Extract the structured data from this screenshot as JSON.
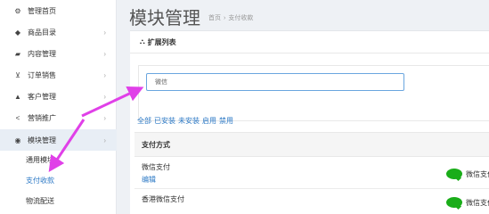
{
  "sidebar": {
    "items": [
      {
        "label": "管理首页",
        "icon": "dashboard-icon",
        "glyph": "⚙"
      },
      {
        "label": "商品目录",
        "icon": "tag-icon",
        "glyph": "◆"
      },
      {
        "label": "内容管理",
        "icon": "book-icon",
        "glyph": "▰"
      },
      {
        "label": "订单销售",
        "icon": "cart-icon",
        "glyph": "⊻"
      },
      {
        "label": "客户管理",
        "icon": "user-icon",
        "glyph": "▲"
      },
      {
        "label": "营销推广",
        "icon": "share-icon",
        "glyph": "<"
      },
      {
        "label": "模块管理",
        "icon": "module-icon",
        "glyph": "◉"
      }
    ],
    "subitems": [
      {
        "label": "通用模块"
      },
      {
        "label": "支付收款"
      },
      {
        "label": "物流配送"
      }
    ]
  },
  "header": {
    "title": "模块管理",
    "breadcrumb": [
      "首页",
      "支付收款"
    ]
  },
  "card": {
    "title": "扩展列表",
    "search_value": "微信",
    "filters": [
      "全部",
      "已安装",
      "未安装",
      "启用",
      "禁用"
    ]
  },
  "table": {
    "header": "支付方式",
    "rows": [
      {
        "name": "微信支付",
        "edit": "编辑",
        "pay_label": "微信支付"
      },
      {
        "name": "香港微信支付",
        "pay_label": "微信支付"
      }
    ]
  },
  "colors": {
    "accent": "#2b78c5",
    "annotation_arrow": "#e040e8",
    "wechat": "#1aad19"
  }
}
